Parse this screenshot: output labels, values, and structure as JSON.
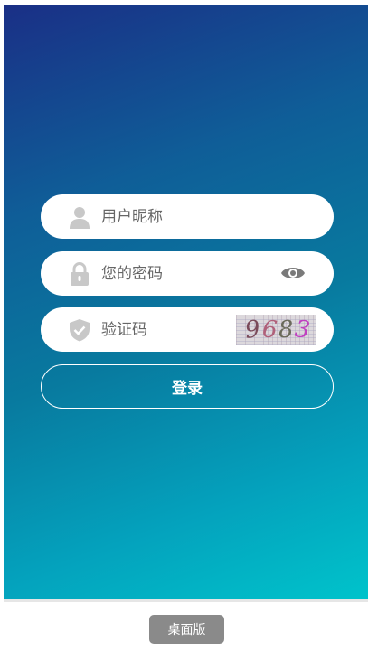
{
  "form": {
    "username": {
      "placeholder": "用户昵称",
      "icon": "user-icon"
    },
    "password": {
      "placeholder": "您的密码",
      "icon": "lock-icon",
      "toggle_icon": "eye-icon"
    },
    "captcha": {
      "placeholder": "验证码",
      "icon": "shield-check-icon",
      "image_text": "9683"
    },
    "login_label": "登录"
  },
  "footer": {
    "desktop_label": "桌面版"
  },
  "colors": {
    "gradient_start": "#1a2f86",
    "gradient_end": "#00c3cb",
    "icon_gray": "#c8c8c8",
    "eye_gray": "#7a7a7a",
    "button_gray": "#8a8a8a"
  }
}
